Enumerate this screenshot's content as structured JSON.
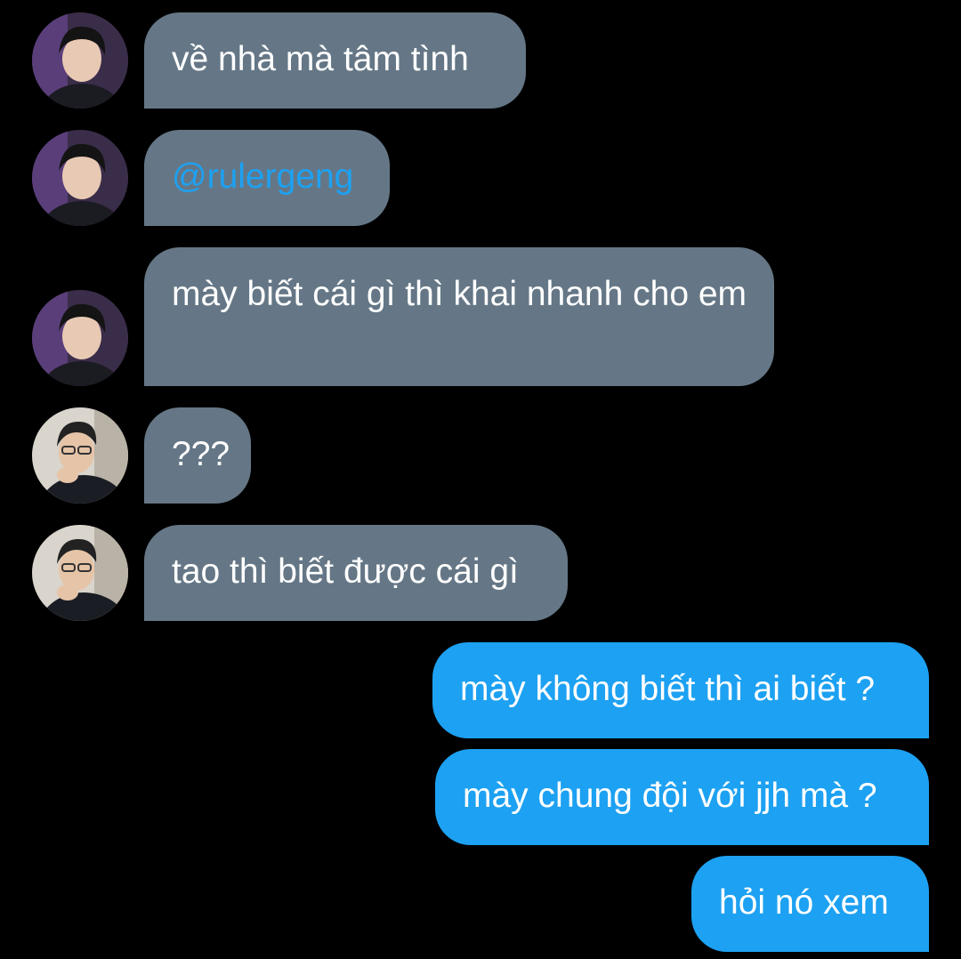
{
  "conversation": {
    "messages": [
      {
        "sender": "ruler",
        "direction": "incoming",
        "text": "về nhà mà tâm tình"
      },
      {
        "sender": "ruler",
        "direction": "incoming",
        "text": "@rulergeng"
      },
      {
        "sender": "ruler",
        "direction": "incoming",
        "text": "mày biết cái gì thì khai nhanh cho em"
      },
      {
        "sender": "other",
        "direction": "incoming",
        "text": "???"
      },
      {
        "sender": "other",
        "direction": "incoming",
        "text": "tao thì biết được cái gì"
      },
      {
        "sender": "me",
        "direction": "outgoing",
        "text": "mày không biết thì ai biết ?"
      },
      {
        "sender": "me",
        "direction": "outgoing",
        "text": "mày chung đội với jjh mà ?"
      },
      {
        "sender": "me",
        "direction": "outgoing",
        "text": "hỏi nó xem"
      }
    ]
  },
  "colors": {
    "background": "#000000",
    "incoming_bubble": "#657786",
    "outgoing_bubble": "#1da1f2",
    "mention_text": "#1da1f2",
    "message_text": "#ffffff"
  }
}
